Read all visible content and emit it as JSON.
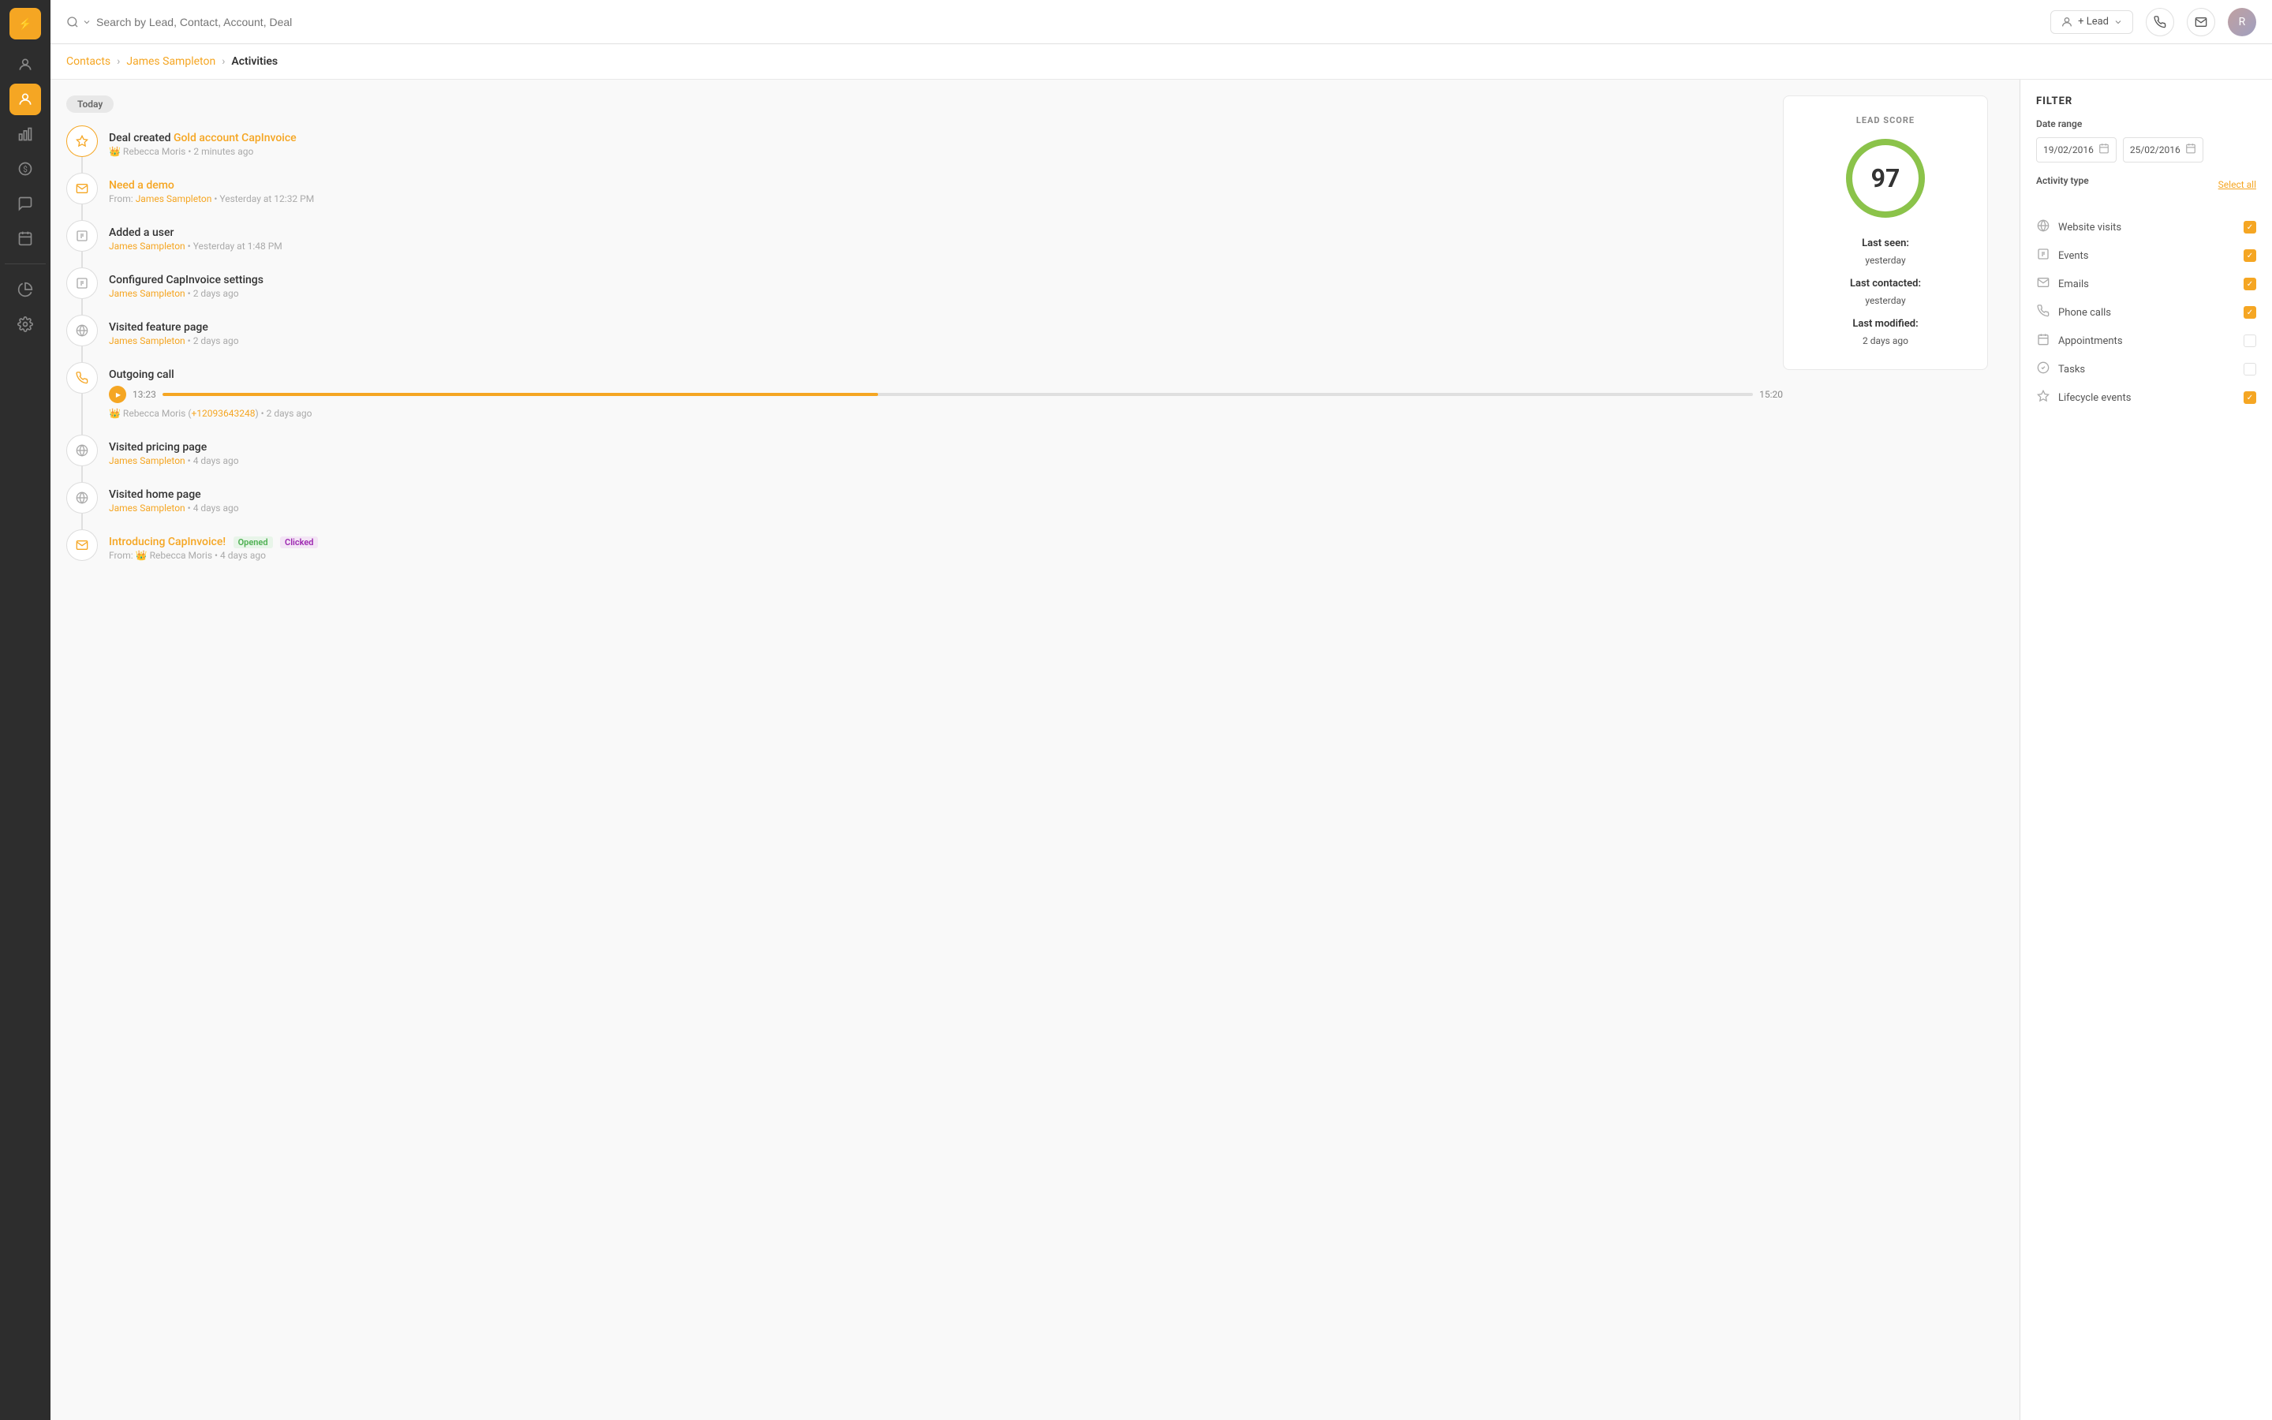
{
  "app": {
    "logo": "⚡"
  },
  "header": {
    "search_placeholder": "Search by Lead, Contact, Account, Deal",
    "lead_button": "+ Lead",
    "phone_icon": "📞",
    "mail_icon": "✉",
    "avatar_text": "R"
  },
  "breadcrumb": {
    "contacts": "Contacts",
    "contact_name": "James Sampleton",
    "current": "Activities"
  },
  "lead_score": {
    "title": "LEAD SCORE",
    "score": "97",
    "last_seen_label": "Last seen:",
    "last_seen_value": "yesterday",
    "last_contacted_label": "Last contacted:",
    "last_contacted_value": "yesterday",
    "last_modified_label": "Last modified:",
    "last_modified_value": "2 days ago"
  },
  "today_label": "Today",
  "timeline": [
    {
      "id": "deal-created",
      "icon": "⭐",
      "icon_type": "gold",
      "title_plain": "Deal created ",
      "title_link": "Gold account CapInvoice",
      "meta": "👑 Rebecca Moris • 2 minutes ago"
    },
    {
      "id": "email-demo",
      "icon": "✉",
      "icon_type": "normal",
      "title_plain": "Need a demo",
      "title_link": "",
      "meta_prefix": "From: ",
      "meta_link": "James Sampleton",
      "meta_suffix": " • Yesterday at 12:32 PM",
      "title_is_link": true
    },
    {
      "id": "added-user",
      "icon": "▣",
      "icon_type": "normal",
      "title_plain": "Added a user",
      "meta_link": "James Sampleton",
      "meta_suffix": " • Yesterday at 1:48 PM"
    },
    {
      "id": "configured",
      "icon": "▣",
      "icon_type": "normal",
      "title_plain": "Configured CapInvoice settings",
      "meta_link": "James Sampleton",
      "meta_suffix": " • 2 days ago"
    },
    {
      "id": "visited-feature",
      "icon": "🌐",
      "icon_type": "normal",
      "title_plain": "Visited feature page",
      "meta_link": "James Sampleton",
      "meta_suffix": " • 2 days ago"
    },
    {
      "id": "outgoing-call",
      "icon": "📞",
      "icon_type": "call",
      "title_plain": "Outgoing call",
      "call_current": "13:23",
      "call_total": "15:20",
      "call_progress": 45,
      "meta": "👑 Rebecca Moris (+12093643248) • 2 days ago"
    },
    {
      "id": "visited-pricing",
      "icon": "🌐",
      "icon_type": "normal",
      "title_plain": "Visited pricing page",
      "meta_link": "James Sampleton",
      "meta_suffix": " • 4 days ago"
    },
    {
      "id": "visited-home",
      "icon": "🌐",
      "icon_type": "normal",
      "title_plain": "Visited home page",
      "meta_link": "James Sampleton",
      "meta_suffix": " • 4 days ago"
    },
    {
      "id": "email-intro",
      "icon": "✉",
      "icon_type": "normal",
      "title_plain": "Introducing CapInvoice!",
      "badge_opened": "Opened",
      "badge_clicked": "Clicked",
      "meta_prefix": "From: 👑 Rebecca Moris • ",
      "meta_suffix": "4 days ago"
    }
  ],
  "filter": {
    "title": "FILTER",
    "date_range_label": "Date range",
    "date_from": "19/02/2016",
    "date_to": "25/02/2016",
    "activity_type_label": "Activity type",
    "select_all": "Select all",
    "items": [
      {
        "id": "website-visits",
        "icon": "🌐",
        "label": "Website visits",
        "checked": true
      },
      {
        "id": "events",
        "icon": "📋",
        "label": "Events",
        "checked": true
      },
      {
        "id": "emails",
        "icon": "✉",
        "label": "Emails",
        "checked": true
      },
      {
        "id": "phone-calls",
        "icon": "📞",
        "label": "Phone calls",
        "checked": true
      },
      {
        "id": "appointments",
        "icon": "📅",
        "label": "Appointments",
        "checked": false
      },
      {
        "id": "tasks",
        "icon": "✅",
        "label": "Tasks",
        "checked": false
      },
      {
        "id": "lifecycle-events",
        "icon": "⭐",
        "label": "Lifecycle events",
        "checked": true
      }
    ]
  },
  "sidebar": {
    "items": [
      {
        "id": "contacts",
        "icon": "👤",
        "active": false
      },
      {
        "id": "contacts-active",
        "icon": "👤",
        "active": true
      },
      {
        "id": "chart",
        "icon": "📊",
        "active": false
      },
      {
        "id": "dollar",
        "icon": "💰",
        "active": false
      },
      {
        "id": "chat",
        "icon": "💬",
        "active": false
      },
      {
        "id": "calendar",
        "icon": "📅",
        "active": false
      },
      {
        "id": "pie",
        "icon": "🥧",
        "active": false
      },
      {
        "id": "settings",
        "icon": "⚙",
        "active": false
      }
    ]
  }
}
